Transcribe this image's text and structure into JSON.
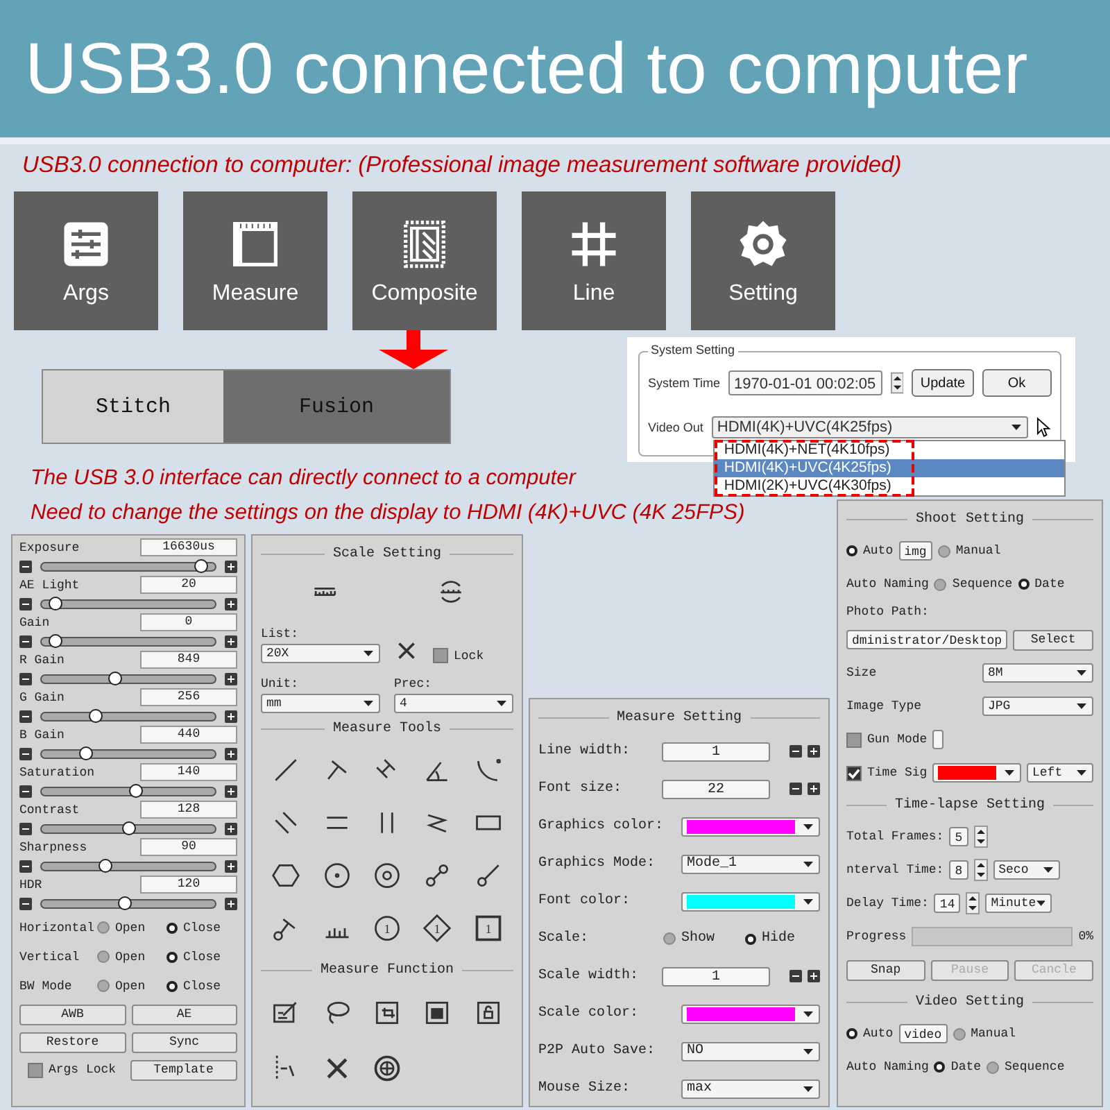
{
  "header": {
    "title": "USB3.0 connected to computer"
  },
  "subtitle": "USB3.0 connection to computer: (Professional image measurement software provided)",
  "tiles": [
    {
      "label": "Args"
    },
    {
      "label": "Measure"
    },
    {
      "label": "Composite"
    },
    {
      "label": "Line"
    },
    {
      "label": "Setting"
    }
  ],
  "composite_tabs": [
    {
      "label": "Stitch",
      "selected": false
    },
    {
      "label": "Fusion",
      "selected": true
    }
  ],
  "system_setting": {
    "title": "System Setting",
    "time_label": "System Time",
    "time": "1970-01-01 00:02:05",
    "update_button": "Update",
    "ok_button": "Ok",
    "video_out_label": "Video Out",
    "video_out": "HDMI(4K)+UVC(4K25fps)",
    "options": [
      {
        "label": "HDMI(4K)+NET(4K10fps)",
        "selected": false
      },
      {
        "label": "HDMI(4K)+UVC(4K25fps)",
        "selected": true
      },
      {
        "label": "HDMI(2K)+UVC(4K30fps)",
        "selected": false
      }
    ]
  },
  "notes": [
    "The USB 3.0 interface can directly connect to a computer",
    "Need to change the settings on the display to HDMI (4K)+UVC (4K 25FPS)"
  ],
  "args_panel": {
    "sliders": [
      {
        "label": "Exposure",
        "value": "16630us",
        "level": 0.95
      },
      {
        "label": "AE Light",
        "value": "20",
        "level": 0.05
      },
      {
        "label": "Gain",
        "value": "0",
        "level": 0.05
      },
      {
        "label": "R Gain",
        "value": "849",
        "level": 0.42
      },
      {
        "label": "G Gain",
        "value": "256",
        "level": 0.3
      },
      {
        "label": "B Gain",
        "value": "440",
        "level": 0.24
      },
      {
        "label": "Saturation",
        "value": "140",
        "level": 0.55
      },
      {
        "label": "Contrast",
        "value": "128",
        "level": 0.5
      },
      {
        "label": "Sharpness",
        "value": "90",
        "level": 0.36
      },
      {
        "label": "HDR",
        "value": "120",
        "level": 0.48
      }
    ],
    "toggles": [
      {
        "label": "Horizontal",
        "options": [
          {
            "label": "Open",
            "selected": false
          },
          {
            "label": "Close",
            "selected": true
          }
        ]
      },
      {
        "label": "Vertical",
        "options": [
          {
            "label": "Open",
            "selected": false
          },
          {
            "label": "Close",
            "selected": true
          }
        ]
      },
      {
        "label": "BW Mode",
        "options": [
          {
            "label": "Open",
            "selected": false
          },
          {
            "label": "Close",
            "selected": true
          }
        ]
      }
    ],
    "buttons": [
      "AWB",
      "AE",
      "Restore",
      "Sync"
    ],
    "args_lock": {
      "label": "Args Lock",
      "checked": false
    },
    "template_button": "Template"
  },
  "scale_panel": {
    "title": "Scale Setting",
    "list_label": "List:",
    "list_value": "20X",
    "lock": {
      "label": "Lock",
      "checked": false
    },
    "unit_label": "Unit:",
    "unit_value": "mm",
    "prec_label": "Prec:",
    "prec_value": "4",
    "tools_title": "Measure Tools",
    "tool_numbers": [
      "1",
      "1",
      "1"
    ],
    "function_title": "Measure Function"
  },
  "measure_panel": {
    "title": "Measure Setting",
    "rows": [
      {
        "kind": "spin",
        "label": "Line width:",
        "value": "1"
      },
      {
        "kind": "spin",
        "label": "Font size:",
        "value": "22"
      },
      {
        "kind": "color",
        "label": "Graphics color:",
        "color": "#ff00ff"
      },
      {
        "kind": "select",
        "label": "Graphics Mode:",
        "value": "Mode_1"
      },
      {
        "kind": "color",
        "label": "Font color:",
        "color": "#00ffff"
      },
      {
        "kind": "radio",
        "label": "Scale:",
        "options": [
          {
            "label": "Show",
            "selected": false
          },
          {
            "label": "Hide",
            "selected": true
          }
        ]
      },
      {
        "kind": "spin",
        "label": "Scale width:",
        "value": "1"
      },
      {
        "kind": "color",
        "label": "Scale color:",
        "color": "#ff00ff"
      },
      {
        "kind": "select",
        "label": "P2P Auto Save:",
        "value": "NO"
      },
      {
        "kind": "select",
        "label": "Mouse Size:",
        "value": "max"
      }
    ]
  },
  "shoot_panel": {
    "title": "Shoot Setting",
    "photo_mode": [
      {
        "label": "Auto",
        "selected": true
      },
      {
        "label": "Manual",
        "selected": false
      }
    ],
    "photo_prefix": "img",
    "photo_naming_label": "Auto Naming",
    "photo_naming": [
      {
        "label": "Sequence",
        "selected": false
      },
      {
        "label": "Date",
        "selected": true
      }
    ],
    "path_label": "Photo Path:",
    "path": "dministrator/Desktop",
    "select_button": "Select",
    "size_label": "Size",
    "size": "8M",
    "type_label": "Image Type",
    "type": "JPG",
    "gun_mode": {
      "label": "Gun Mode",
      "checked": false
    },
    "time_sign": {
      "label": "Time Sig",
      "checked": true,
      "color": "#ff0000",
      "position": "Left"
    },
    "timelapse_title": "Time-lapse Setting",
    "total_frames_label": "Total Frames:",
    "total_frames": "5",
    "interval_label": "nterval Time:",
    "interval": "8",
    "interval_unit": "Seco",
    "delay_label": "Delay Time:",
    "delay": "14",
    "delay_unit": "Minute",
    "progress_label": "Progress",
    "progress": {
      "level": 0
    },
    "progress_text": "0%",
    "buttons": [
      {
        "label": "Snap",
        "disabled": false
      },
      {
        "label": "Pause",
        "disabled": true
      },
      {
        "label": "Cancle",
        "disabled": true
      }
    ],
    "video_title": "Video Setting",
    "video_mode": [
      {
        "label": "Auto",
        "selected": true
      },
      {
        "label": "Manual",
        "selected": false
      }
    ],
    "video_prefix": "video",
    "video_naming_label": "Auto Naming",
    "video_naming": [
      {
        "label": "Date",
        "selected": true
      },
      {
        "label": "Sequence",
        "selected": false
      }
    ]
  }
}
